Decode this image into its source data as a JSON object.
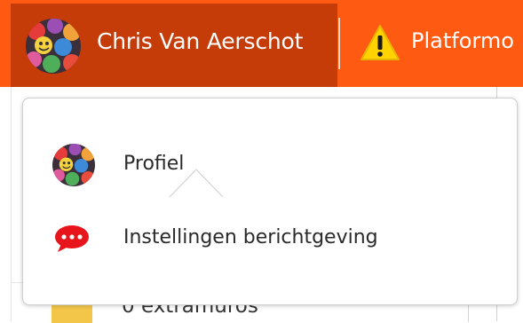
{
  "topbar": {
    "user_name": "Chris Van Aerschot",
    "platform_text": "Platformo",
    "colors": {
      "bar": "#ff5a12",
      "user_segment": "#c53c09"
    }
  },
  "dropdown": {
    "items": [
      {
        "label": "Profiel",
        "icon": "avatar-icon"
      },
      {
        "label": "Instellingen berichtgeving",
        "icon": "chat-bubble-icon",
        "icon_color": "#e8141b"
      }
    ]
  },
  "background": {
    "rows": [
      {
        "label": "0  extramuros",
        "icon": "folder-icon"
      }
    ]
  }
}
